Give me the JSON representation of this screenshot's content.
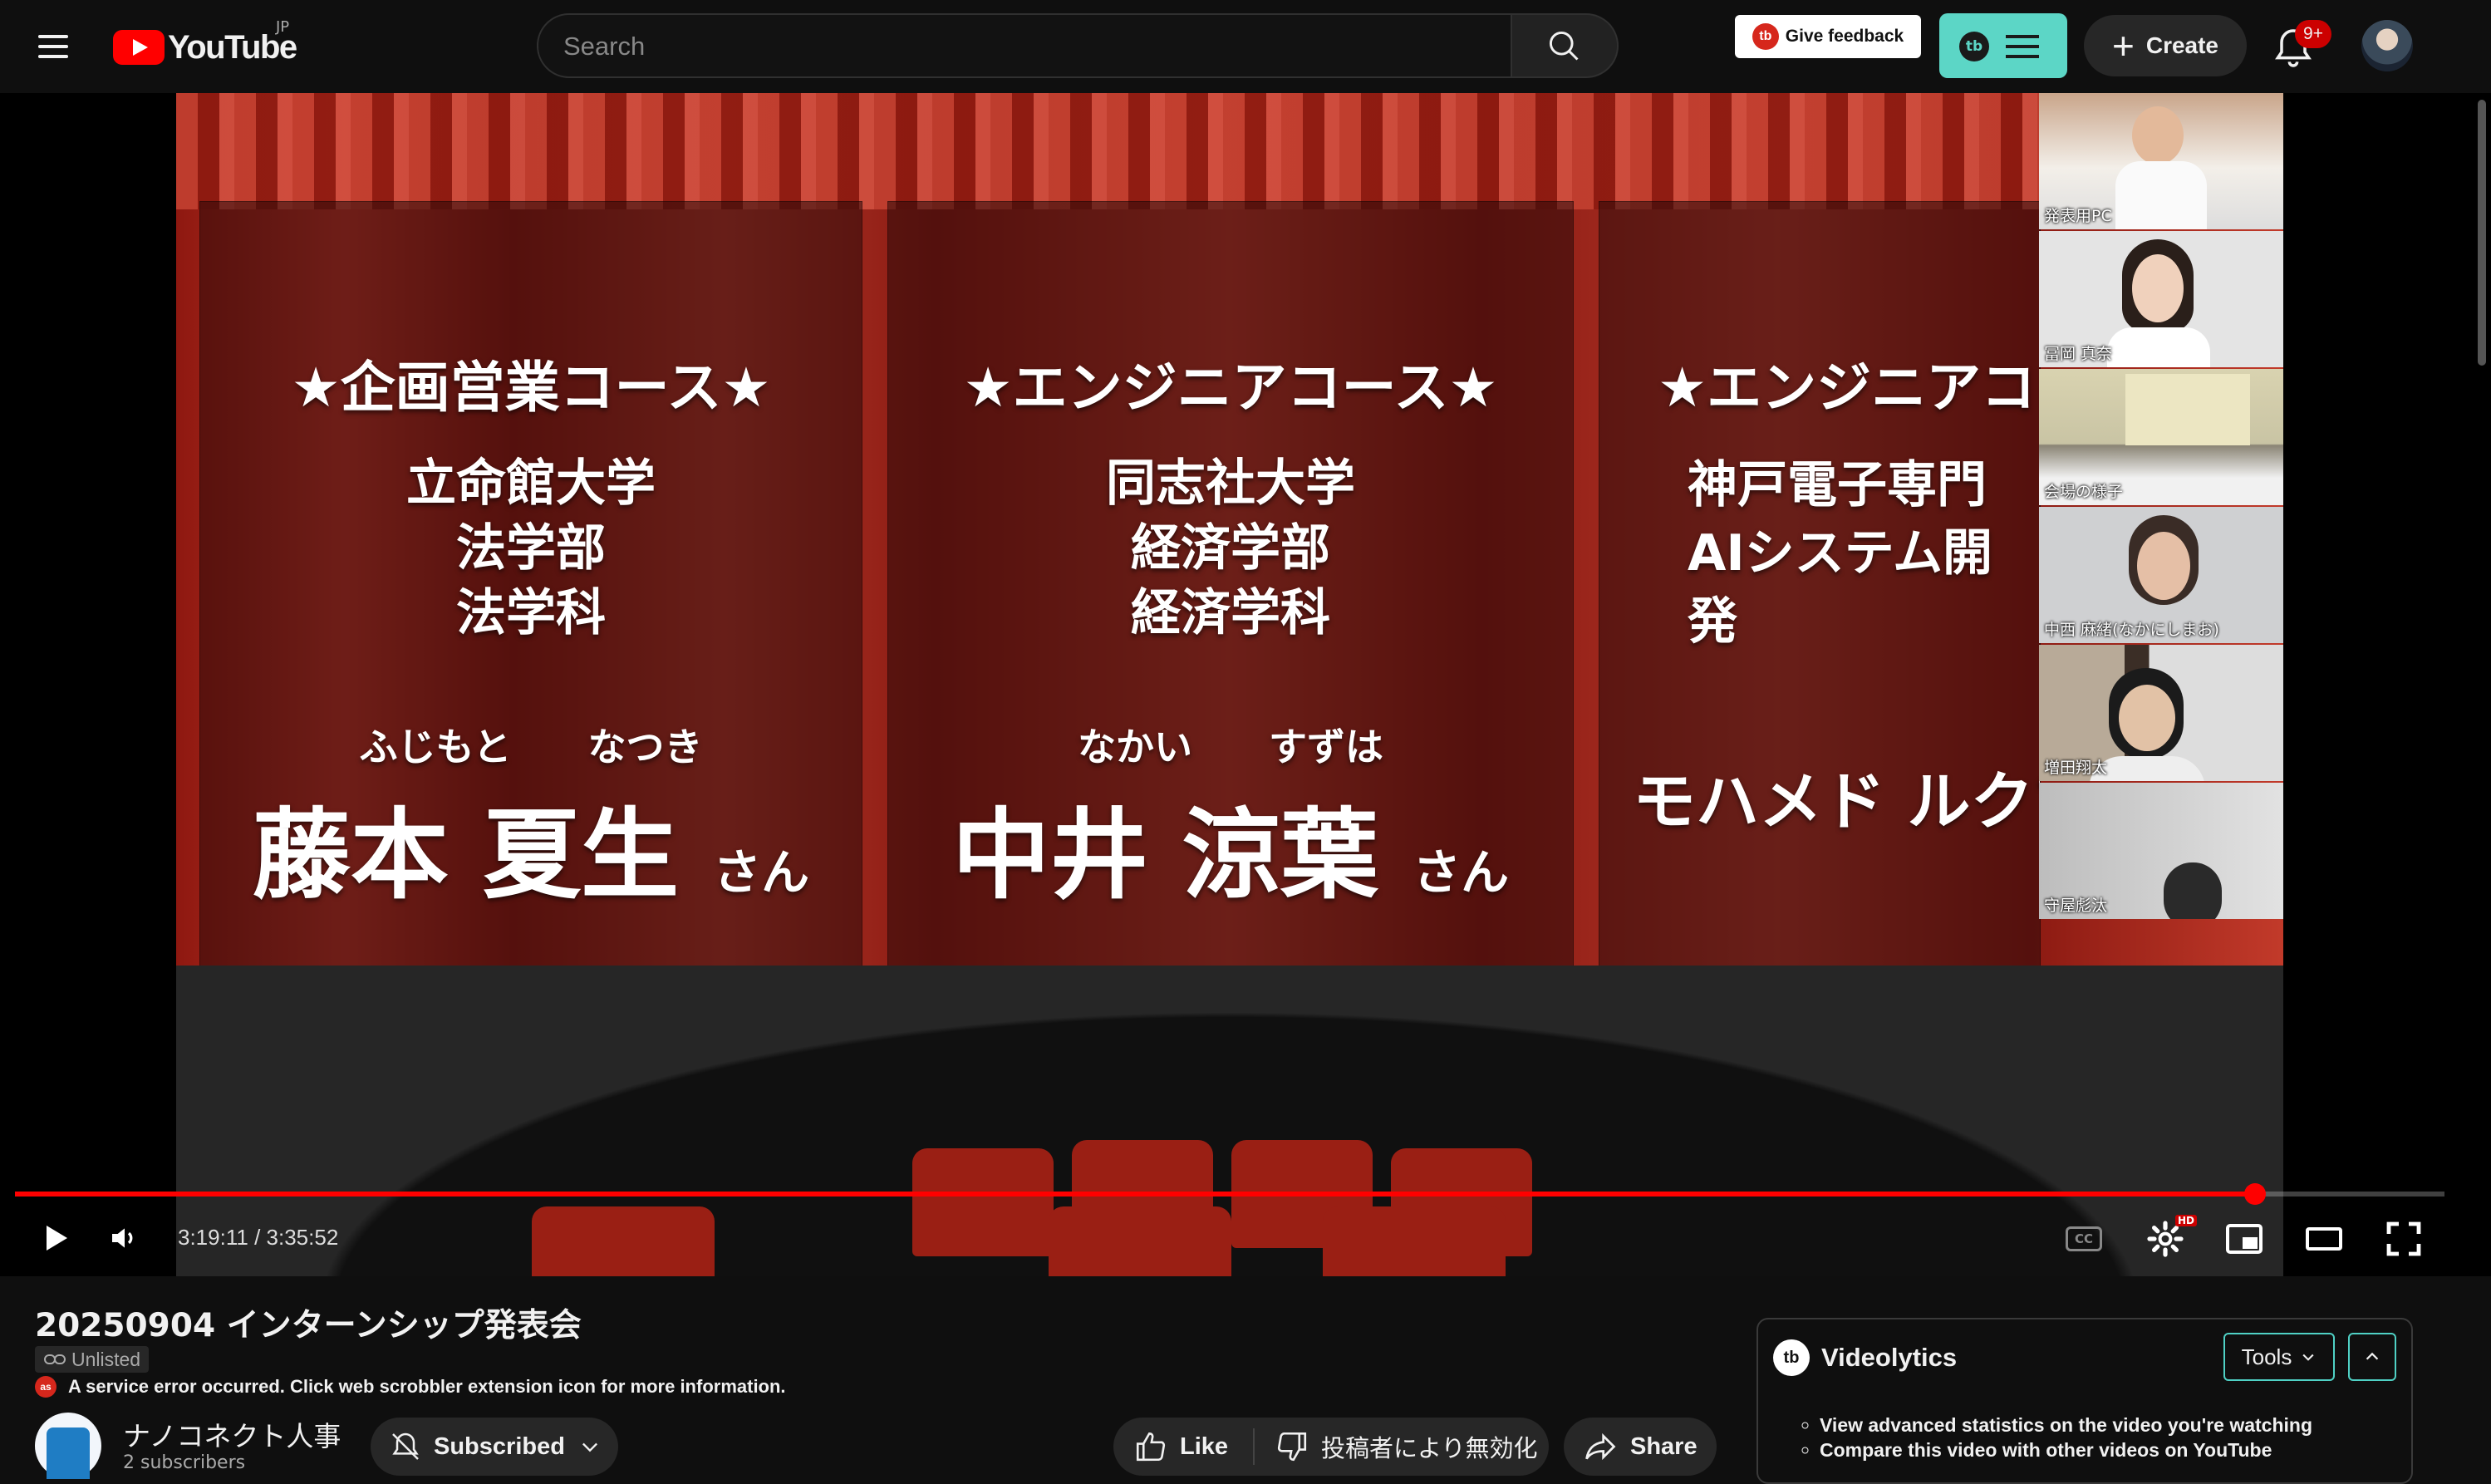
{
  "header": {
    "logo_text": "YouTube",
    "region": "JP",
    "search_placeholder": "Search",
    "feedback_label": "Give feedback",
    "create_label": "Create",
    "notification_count": "9+"
  },
  "video": {
    "slides": [
      {
        "headline": "★企画営業コース★",
        "school": "立命館大学\n法学部\n法学科",
        "ruby_family": "ふじもと",
        "ruby_given": "なつき",
        "name": "藤本 夏生",
        "suffix": "さん"
      },
      {
        "headline": "★エンジニアコース★",
        "school": "同志社大学\n経済学部\n経済学科",
        "ruby_family": "なかい",
        "ruby_given": "すずは",
        "name": "中井 涼葉",
        "suffix": "さん"
      },
      {
        "headline": "★エンジニアコ",
        "school": "神戸電子専門\nAIシステム開発",
        "ruby_family": "",
        "ruby_given": "",
        "name": "モハメド ルクマ",
        "suffix": ""
      }
    ],
    "participants": [
      "発表用PC",
      "冨岡 真奈",
      "会場の様子",
      "中西 麻緒(なかにしまお)",
      "増田翔太",
      "守屋彪汰"
    ],
    "time_current": "3:19:11",
    "time_separator": "/",
    "time_total": "3:35:52",
    "progress": 0.922,
    "hd_badge": "HD"
  },
  "details": {
    "title": "20250904 インターンシップ発表会",
    "visibility": "Unlisted",
    "error_message": "A service error occurred. Click web scrobbler extension icon for more information.",
    "channel_name": "ナノコネクト人事",
    "subscribers": "2 subscribers",
    "subscribed_label": "Subscribed",
    "like_label": "Like",
    "dislike_label": "投稿者により無効化",
    "share_label": "Share"
  },
  "videolytics": {
    "title": "Videolytics",
    "tools_label": "Tools",
    "items": [
      "View advanced statistics on the video you're watching",
      "Compare this video with other videos on YouTube"
    ]
  },
  "colors": {
    "accent": "#ff0000",
    "teal": "#5cd6c6",
    "background": "#0f0f0f"
  }
}
